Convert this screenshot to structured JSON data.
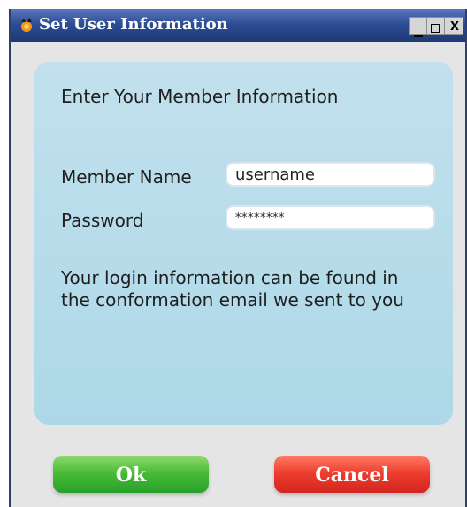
{
  "window": {
    "title": "Set User Information",
    "icons": {
      "app": "app-icon",
      "minimize": "minimize-icon",
      "maximize": "maximize-icon",
      "close": "close-icon"
    },
    "buttons": {
      "close_symbol": "X"
    }
  },
  "form": {
    "title": "Enter Your Member Information",
    "member_name_label": "Member Name",
    "member_name_value": "username",
    "password_label": "Password",
    "password_value": "********",
    "help_text": "Your login information can be found in the conformation email we sent to you"
  },
  "actions": {
    "ok_label": "Ok",
    "cancel_label": "Cancel"
  },
  "colors": {
    "title_bar": "#2c4d95",
    "panel": "#b6dcea",
    "ok": "#48bb34",
    "cancel": "#ec3d2e"
  }
}
